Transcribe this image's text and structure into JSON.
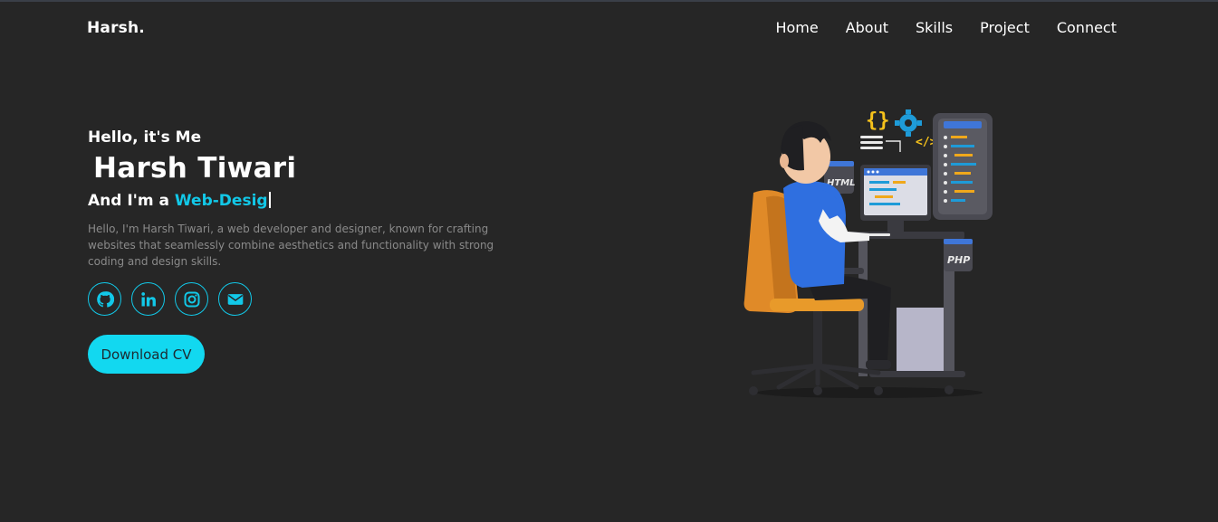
{
  "brand": {
    "logo": "Harsh."
  },
  "nav": {
    "items": [
      "Home",
      "About",
      "Skills",
      "Project",
      "Connect"
    ]
  },
  "hero": {
    "greeting": "Hello, it's Me",
    "name": "Harsh Tiwari",
    "role_prefix": "And I'm a ",
    "role_typed": "Web-Desig",
    "intro": "Hello, I'm Harsh Tiwari, a web developer and designer, known for crafting websites that seamlessly combine aesthetics and functionality with strong coding and design skills.",
    "cv_button": "Download CV"
  },
  "illustration": {
    "html_label": "HTML",
    "php_label": "PHP"
  },
  "socials": [
    {
      "icon": "github-icon"
    },
    {
      "icon": "linkedin-icon"
    },
    {
      "icon": "instagram-icon"
    },
    {
      "icon": "envelope-icon"
    }
  ],
  "colors": {
    "background": "#262626",
    "accent": "#12c8e8",
    "button": "#12d8f0",
    "muted_text": "#8a8a8a"
  }
}
